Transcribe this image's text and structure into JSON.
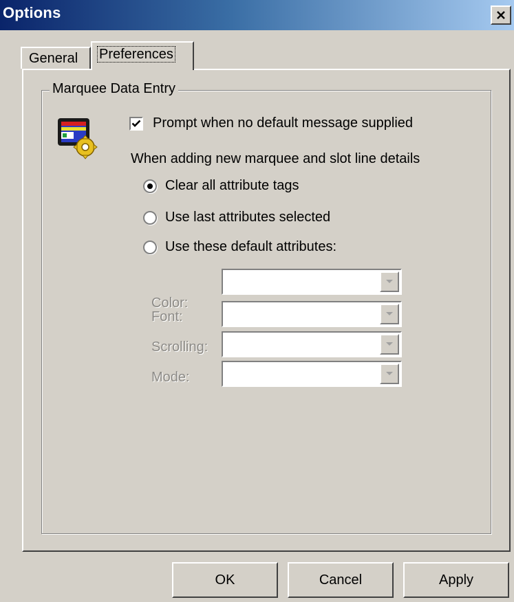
{
  "window": {
    "title": "Options"
  },
  "tabs": [
    {
      "label": "General",
      "selected": false
    },
    {
      "label": "Preferences",
      "selected": true
    }
  ],
  "group": {
    "legend": "Marquee Data Entry"
  },
  "prompt_checkbox": {
    "label": "Prompt when no default message supplied",
    "checked": true
  },
  "attributes_intro": "When adding new marquee and slot line details",
  "radios": [
    {
      "label": "Clear all attribute tags",
      "selected": true
    },
    {
      "label": "Use last attributes selected",
      "selected": false
    },
    {
      "label": "Use these default attributes:",
      "selected": false
    }
  ],
  "fields": [
    {
      "label": "Color:",
      "value": ""
    },
    {
      "label": "Font:",
      "value": ""
    },
    {
      "label": "Scrolling:",
      "value": ""
    },
    {
      "label": "Mode:",
      "value": ""
    }
  ],
  "buttons": {
    "ok": "OK",
    "cancel": "Cancel",
    "apply": "Apply"
  },
  "colors": {
    "face": "#d4d0c8",
    "title_start": "#0a246a",
    "title_end": "#a6caf0",
    "disabled_text": "#8c8a86"
  }
}
